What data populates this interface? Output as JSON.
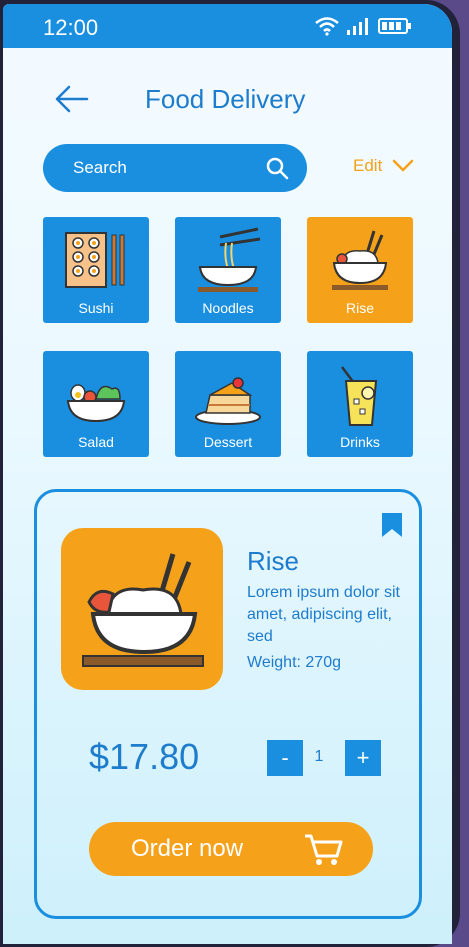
{
  "status_bar": {
    "time": "12:00"
  },
  "header": {
    "title": "Food Delivery"
  },
  "search": {
    "label": "Search"
  },
  "edit": {
    "label": "Edit"
  },
  "categories": [
    {
      "label": "Sushi",
      "active": false
    },
    {
      "label": "Noodles",
      "active": false
    },
    {
      "label": "Rise",
      "active": true
    },
    {
      "label": "Salad",
      "active": false
    },
    {
      "label": "Dessert",
      "active": false
    },
    {
      "label": "Drinks",
      "active": false
    }
  ],
  "product": {
    "name": "Rise",
    "description": "Lorem ipsum dolor sit amet, adipiscing elit, sed",
    "weight": "Weight: 270g",
    "price": "$17.80",
    "quantity": "1",
    "decrement_label": "-",
    "increment_label": "+",
    "order_label": "Order now"
  },
  "colors": {
    "accent_blue": "#1a8fe0",
    "accent_orange": "#f5a11a",
    "text_blue": "#1e7ccc"
  }
}
